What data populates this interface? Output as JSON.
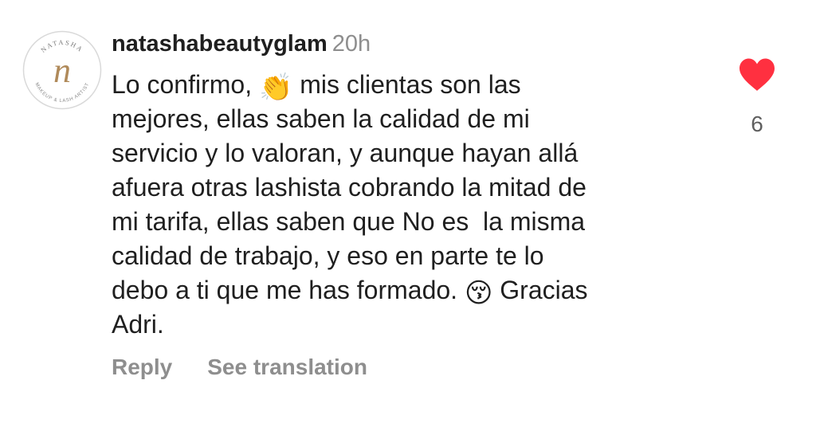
{
  "comment": {
    "avatar_text": {
      "top": "NATASHA",
      "monogram": "n",
      "bottom": "MAKEUP & LASH ARTIST"
    },
    "username": "natashabeautyglam",
    "time": "20h",
    "body": {
      "l1_pre": "Lo confirmo,",
      "clap_emoji": "👏",
      "l1_post": "mis clientas son las",
      "l2": "mejores, ellas saben la calidad de mi",
      "l3": "servicio y lo valoran, y aunque hayan allá",
      "l4": "afuera otras lashista cobrando la mitad de",
      "l5": "mi tarifa, ellas saben que No es  la misma",
      "l6": "calidad de trabajo, y eso en parte te lo",
      "l7_pre": "debo a ti que me has formado.",
      "kiss_emoji": "😚",
      "l7_post": "Gracias",
      "l8": "Adri."
    },
    "actions": {
      "reply": "Reply",
      "see_translation": "See translation"
    },
    "like": {
      "icon": "heart-icon",
      "count": "6",
      "color": "#ff3040"
    }
  }
}
